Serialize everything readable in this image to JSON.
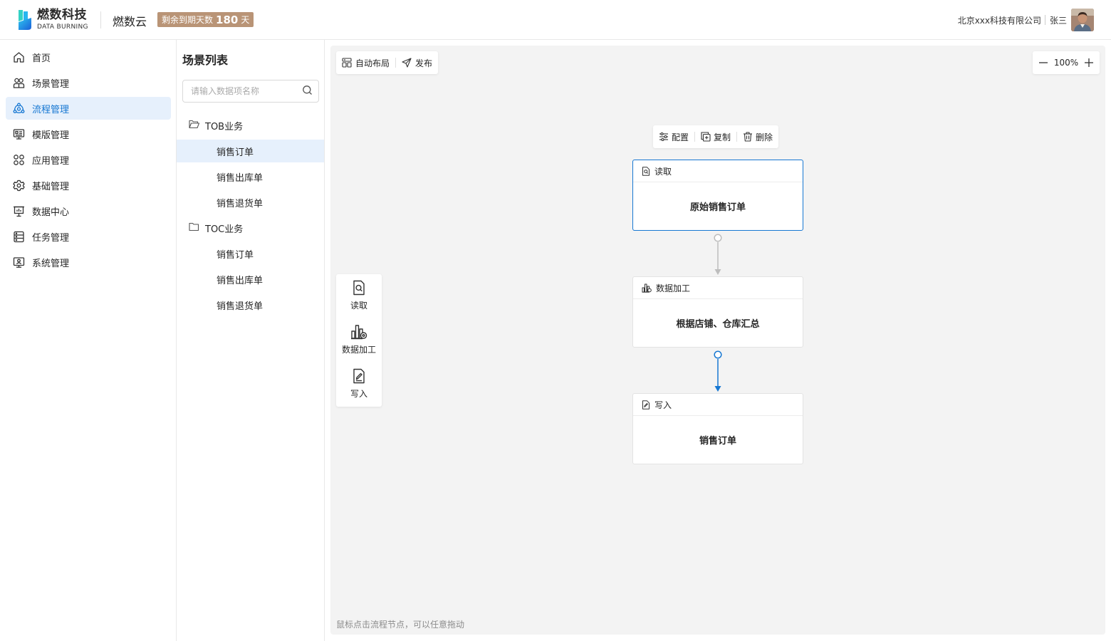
{
  "header": {
    "logo_cn": "燃数科技",
    "logo_en": "DATA BURNING",
    "product": "燃数云",
    "expiry_prefix": "剩余到期天数",
    "expiry_days": "180",
    "expiry_suffix": "天",
    "company": "北京xxx科技有限公司",
    "user": "张三"
  },
  "sidebar": {
    "items": [
      {
        "label": "首页",
        "icon": "home-icon"
      },
      {
        "label": "场景管理",
        "icon": "users-icon"
      },
      {
        "label": "流程管理",
        "icon": "flow-icon",
        "active": true
      },
      {
        "label": "模版管理",
        "icon": "template-icon"
      },
      {
        "label": "应用管理",
        "icon": "apps-icon"
      },
      {
        "label": "基础管理",
        "icon": "gear-icon"
      },
      {
        "label": "数据中心",
        "icon": "monitor-chart-icon"
      },
      {
        "label": "任务管理",
        "icon": "task-icon"
      },
      {
        "label": "系统管理",
        "icon": "system-icon"
      }
    ]
  },
  "scene_panel": {
    "title": "场景列表",
    "search_placeholder": "请输入数据项名称",
    "groups": [
      {
        "label": "TOB业务",
        "expanded": true,
        "items": [
          "销售订单",
          "销售出库单",
          "销售退货单"
        ]
      },
      {
        "label": "TOC业务",
        "expanded": false,
        "items": [
          "销售订单",
          "销售出库单",
          "销售退货单"
        ]
      }
    ]
  },
  "canvas": {
    "toolbar": {
      "auto_layout": "自动布局",
      "publish": "发布"
    },
    "zoom": "100%",
    "palette": [
      {
        "label": "读取",
        "icon": "file-search-icon"
      },
      {
        "label": "数据加工",
        "icon": "data-process-icon"
      },
      {
        "label": "写入",
        "icon": "file-edit-icon"
      }
    ],
    "node_actions": {
      "config": "配置",
      "copy": "复制",
      "delete": "删除"
    },
    "nodes": [
      {
        "type": "读取",
        "name": "原始销售订单",
        "selected": true
      },
      {
        "type": "数据加工",
        "name": "根据店铺、仓库汇总"
      },
      {
        "type": "写入",
        "name": "销售订单"
      }
    ],
    "hint": "鼠标点击流程节点，可以任意拖动"
  },
  "colors": {
    "accent": "#1677d2",
    "badge": "#b99476",
    "canvas_bg": "#f3f3f3",
    "selected_bg": "#e6f0fc"
  }
}
